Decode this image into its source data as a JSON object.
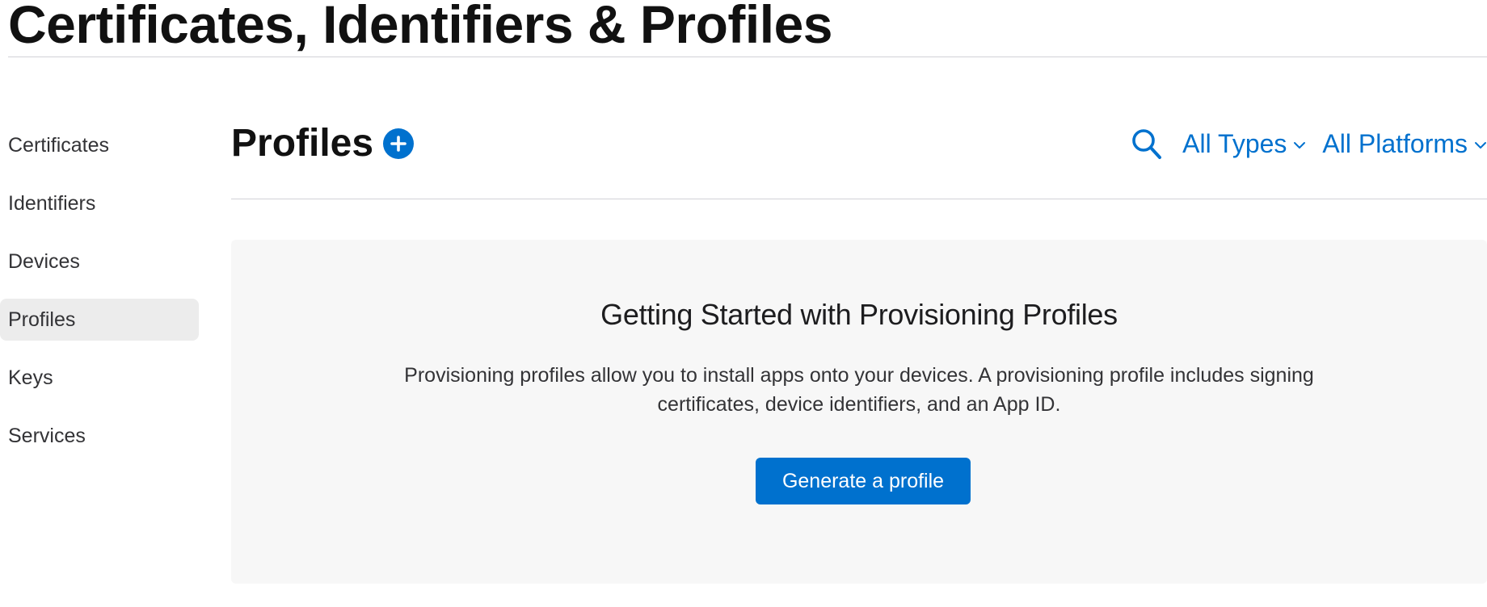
{
  "page": {
    "title": "Certificates, Identifiers & Profiles"
  },
  "sidebar": {
    "items": [
      {
        "label": "Certificates",
        "active": false
      },
      {
        "label": "Identifiers",
        "active": false
      },
      {
        "label": "Devices",
        "active": false
      },
      {
        "label": "Profiles",
        "active": true
      },
      {
        "label": "Keys",
        "active": false
      },
      {
        "label": "Services",
        "active": false
      }
    ]
  },
  "main": {
    "section_title": "Profiles",
    "add_icon": "plus-circle-icon",
    "search_icon": "search-icon",
    "filters": {
      "types_label": "All Types",
      "platforms_label": "All Platforms"
    },
    "empty_state": {
      "heading": "Getting Started with Provisioning Profiles",
      "description": "Provisioning profiles allow you to install apps onto your devices. A provisioning profile includes signing certificates, device identifiers, and an App ID.",
      "button_label": "Generate a profile"
    }
  },
  "colors": {
    "accent": "#0071ce",
    "sidebar_active_bg": "#ececec",
    "panel_bg": "#f7f7f7",
    "divider": "#d2d2d7"
  }
}
